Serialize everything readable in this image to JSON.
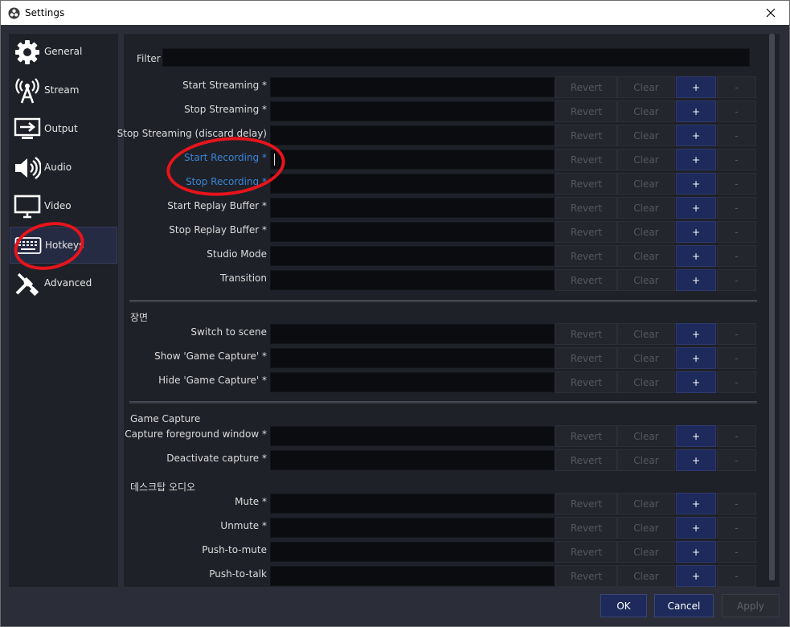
{
  "window": {
    "title": "Settings"
  },
  "sidebar": {
    "items": [
      {
        "label": "General",
        "icon": "gear-icon"
      },
      {
        "label": "Stream",
        "icon": "broadcast-icon"
      },
      {
        "label": "Output",
        "icon": "output-icon"
      },
      {
        "label": "Audio",
        "icon": "speaker-icon"
      },
      {
        "label": "Video",
        "icon": "monitor-icon"
      },
      {
        "label": "Hotkeys",
        "icon": "keyboard-icon",
        "active": true
      },
      {
        "label": "Advanced",
        "icon": "tools-icon"
      }
    ]
  },
  "filter": {
    "label": "Filter",
    "value": ""
  },
  "buttons": {
    "revert": "Revert",
    "clear": "Clear",
    "add": "+",
    "remove": "-"
  },
  "groups": {
    "general": {
      "rows": [
        "Start Streaming *",
        "Stop Streaming *",
        "Stop Streaming (discard delay)",
        "Start Recording *",
        "Stop Recording *",
        "Start Replay Buffer *",
        "Stop Replay Buffer *",
        "Studio Mode",
        "Transition"
      ]
    },
    "scene": {
      "title": "장면",
      "rows": [
        "Switch to scene",
        "Show 'Game Capture' *",
        "Hide 'Game Capture' *"
      ]
    },
    "game_capture": {
      "title": "Game Capture",
      "rows": [
        "Capture foreground window *",
        "Deactivate capture *"
      ]
    },
    "desktop_audio": {
      "title": "데스크탑 오디오",
      "rows": [
        "Mute *",
        "Unmute *",
        "Push-to-mute",
        "Push-to-talk"
      ]
    }
  },
  "footer": {
    "ok": "OK",
    "cancel": "Cancel",
    "apply": "Apply"
  },
  "colors": {
    "accent": "#1d2a5b",
    "highlight_text": "#3a86d6",
    "annotation": "#e8141b"
  }
}
